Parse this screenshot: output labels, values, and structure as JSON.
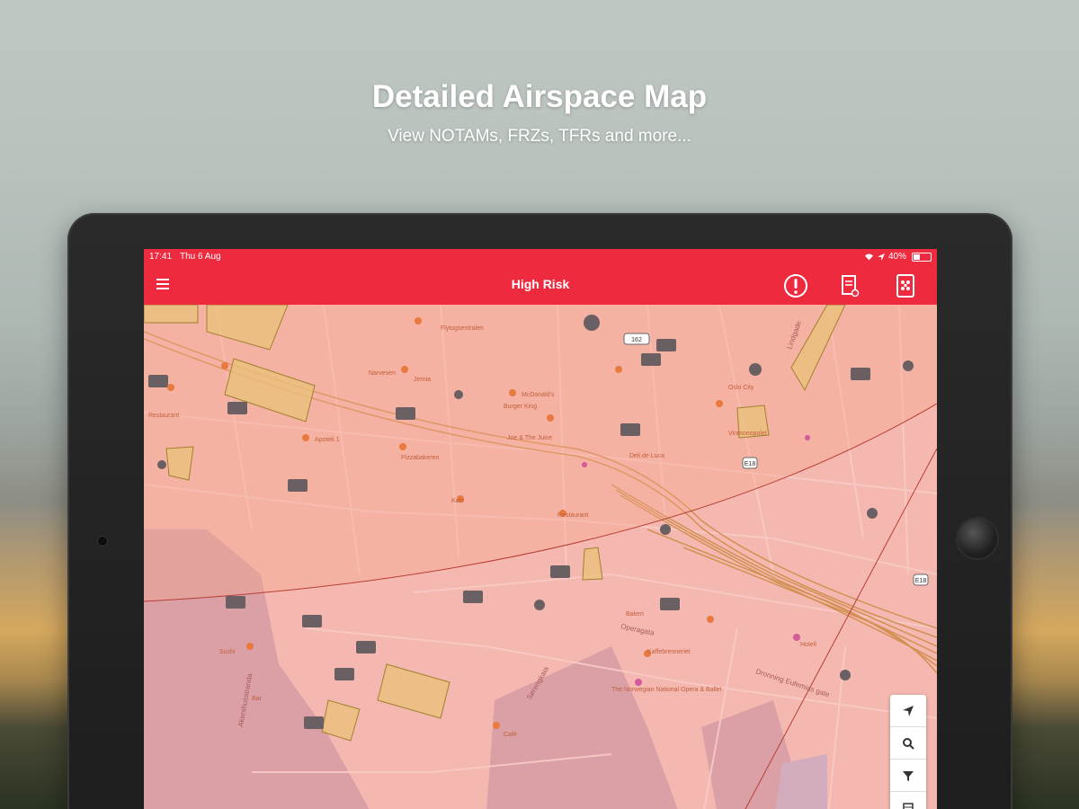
{
  "promo": {
    "headline": "Detailed Airspace Map",
    "subheadline": "View NOTAMs, FRZs, TFRs and more..."
  },
  "statusbar": {
    "time": "17:41",
    "date": "Thu 6 Aug",
    "battery_text": "40%",
    "battery_level": 0.4
  },
  "navbar": {
    "title": "High Risk",
    "icons": [
      "menu-icon",
      "alert-icon",
      "checklist-icon",
      "drone-icon"
    ]
  },
  "map": {
    "risk_color": "#f2897f",
    "zone_color": "#e9c27a",
    "road_labels": [
      "Lindgade",
      "Sørengkaia",
      "Dronning Eufemias gate",
      "Operagata",
      "Akershusstranda"
    ],
    "poi_labels": [
      "Flytogsentralen",
      "Jernia",
      "McDonald's",
      "Burger King",
      "Joe & The Juice",
      "Apotek 1",
      "Narvesen",
      "Pizzabakeren",
      "Kafé",
      "Restaurant",
      "Vinmonopolet",
      "Deli de Luca",
      "Oslo City",
      "The Norwegian National Opera & Ballet",
      "Kaffebrenneriet",
      "Bakeri",
      "Sushi",
      "Bar",
      "Café",
      "Restaurant",
      "Hotell"
    ],
    "route_badges": [
      "162",
      "E18",
      "E18"
    ]
  },
  "controls": [
    "locate-icon",
    "zoom-icon",
    "filter-icon",
    "layers-icon"
  ]
}
